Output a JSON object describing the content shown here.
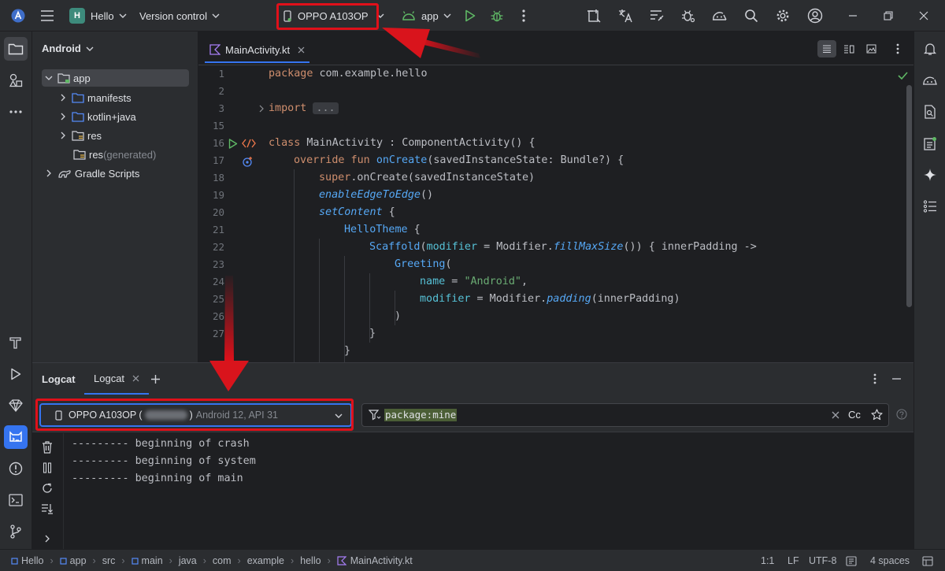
{
  "titlebar": {
    "project_badge": "H",
    "project_name": "Hello",
    "vcs_label": "Version control",
    "device_label": "OPPO A103OP",
    "run_config": "app"
  },
  "project_panel": {
    "title": "Android",
    "items": [
      {
        "label": "app",
        "suffix": ""
      },
      {
        "label": "manifests",
        "suffix": ""
      },
      {
        "label": "kotlin+java",
        "suffix": ""
      },
      {
        "label": "res",
        "suffix": ""
      },
      {
        "label": "res",
        "suffix": " (generated)"
      },
      {
        "label": "Gradle Scripts",
        "suffix": ""
      }
    ]
  },
  "editor": {
    "tab": "MainActivity.kt",
    "line_numbers": [
      "1",
      "2",
      "3",
      "15",
      "16",
      "17",
      "18",
      "19",
      "20",
      "21",
      "22",
      "23",
      "24",
      "25",
      "26",
      "27"
    ],
    "code": {
      "l1_kw": "package",
      "l1_rest": " com.example.hello",
      "l3_kw": "import",
      "l3_fold": "...",
      "l16_kw": "class",
      "l16_rest": " MainActivity : ComponentActivity() {",
      "l17_kw": "override fun",
      "l17_fn": "onCreate",
      "l17_rest": "(savedInstanceState: Bundle?) {",
      "l18_kw": "super",
      "l18_rest": ".onCreate(savedInstanceState)",
      "l19_it": "enableEdgeToEdge",
      "l19_rest": "()",
      "l20_it": "setContent",
      "l20_rest": " {",
      "l21_fn": "HelloTheme",
      "l21_rest": " {",
      "l22_fn": "Scaffold",
      "l22_a": "(",
      "l22_prm": "modifier",
      "l22_b": " = Modifier.",
      "l22_it": "fillMaxSize",
      "l22_c": "()) { innerPadding ->",
      "l23_fn": "Greeting",
      "l23_rest": "(",
      "l24_prm": "name",
      "l24_a": " = ",
      "l24_str": "\"Android\"",
      "l24_b": ",",
      "l25_prm": "modifier",
      "l25_a": " = Modifier.",
      "l25_it": "padding",
      "l25_b": "(innerPadding)",
      "l26": ")",
      "l27": "}",
      "l28": "}"
    }
  },
  "logcat": {
    "title": "Logcat",
    "tab": "Logcat",
    "device": {
      "name": "OPPO A103OP (",
      "after_serial": ")",
      "info": "Android 12, API 31"
    },
    "filter_value": "package:mine",
    "case_label": "Cc",
    "lines": [
      "--------- beginning of crash",
      "--------- beginning of system",
      "--------- beginning of main"
    ]
  },
  "statusbar": {
    "breadcrumbs": [
      "Hello",
      "app",
      "src",
      "main",
      "java",
      "com",
      "example",
      "hello",
      "MainActivity.kt"
    ],
    "position": "1:1",
    "line_sep": "LF",
    "encoding": "UTF-8",
    "indent": "4 spaces"
  },
  "colors": {
    "annotation_red": "#e0101a",
    "accent_blue": "#3574f0",
    "run_green": "#5fb865"
  }
}
